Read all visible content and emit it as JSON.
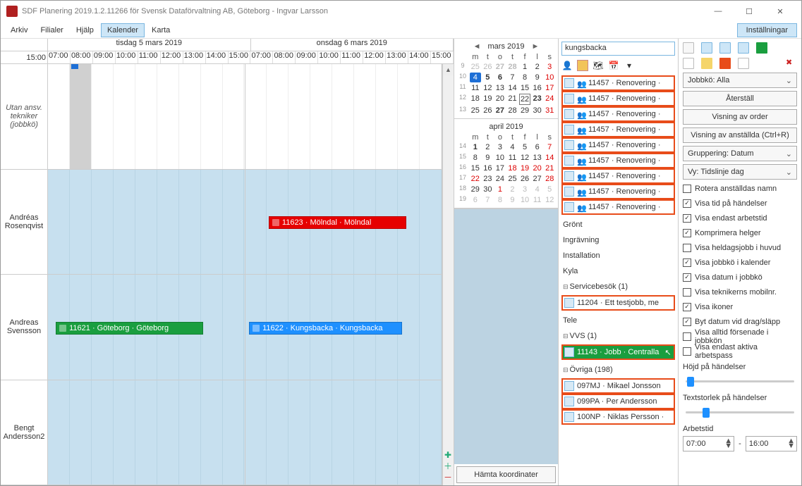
{
  "title": "SDF Planering 2019.1.2.11266 för Svensk Dataförvaltning AB, Göteborg - Ingvar Larsson",
  "menu": {
    "arkiv": "Arkiv",
    "filialer": "Filialer",
    "hjalp": "Hjälp",
    "kalender": "Kalender",
    "karta": "Karta",
    "installningar": "Inställningar"
  },
  "timeline": {
    "day1": "tisdag 5 mars 2019",
    "day2": "onsdag 6 mars 2019",
    "left_hour": "15:00",
    "hours": [
      "07:00",
      "08:00",
      "09:00",
      "10:00",
      "11:00",
      "12:00",
      "13:00",
      "14:00",
      "15:00"
    ],
    "rows": {
      "r0": "Utan ansv. tekniker (jobbkö)",
      "r1": "Andréas Rosenqvist",
      "r2": "Andreas Svensson",
      "r3": "Bengt Andersson2"
    },
    "events": {
      "e1": "11623 · Mölndal · Mölndal",
      "e2": "11621 · Göteborg · Göteborg",
      "e3": "11622 · Kungsbacka · Kungsbacka"
    }
  },
  "cal": {
    "mar": {
      "title": "mars 2019",
      "dow": [
        "m",
        "t",
        "o",
        "t",
        "f",
        "l",
        "s"
      ],
      "weeks": [
        {
          "wk": "9",
          "days": [
            {
              "n": "25",
              "g": 1
            },
            {
              "n": "26",
              "g": 1
            },
            {
              "n": "27",
              "g": 1,
              "b": 1
            },
            {
              "n": "28",
              "g": 1,
              "b": 1
            },
            {
              "n": "1"
            },
            {
              "n": "2"
            },
            {
              "n": "3",
              "r": 1
            }
          ]
        },
        {
          "wk": "10",
          "days": [
            {
              "n": "4",
              "today": 1
            },
            {
              "n": "5",
              "b": 1
            },
            {
              "n": "6",
              "b": 1
            },
            {
              "n": "7"
            },
            {
              "n": "8"
            },
            {
              "n": "9"
            },
            {
              "n": "10",
              "r": 1
            }
          ]
        },
        {
          "wk": "11",
          "days": [
            {
              "n": "11"
            },
            {
              "n": "12"
            },
            {
              "n": "13"
            },
            {
              "n": "14"
            },
            {
              "n": "15"
            },
            {
              "n": "16"
            },
            {
              "n": "17",
              "r": 1
            }
          ]
        },
        {
          "wk": "12",
          "days": [
            {
              "n": "18"
            },
            {
              "n": "19"
            },
            {
              "n": "20"
            },
            {
              "n": "21"
            },
            {
              "n": "22",
              "box": 1
            },
            {
              "n": "23",
              "b": 1
            },
            {
              "n": "24",
              "r": 1
            }
          ]
        },
        {
          "wk": "13",
          "days": [
            {
              "n": "25"
            },
            {
              "n": "26"
            },
            {
              "n": "27",
              "b": 1
            },
            {
              "n": "28"
            },
            {
              "n": "29"
            },
            {
              "n": "30"
            },
            {
              "n": "31",
              "r": 1
            }
          ]
        }
      ]
    },
    "apr": {
      "title": "april 2019",
      "dow": [
        "m",
        "t",
        "o",
        "t",
        "f",
        "l",
        "s"
      ],
      "weeks": [
        {
          "wk": "14",
          "days": [
            {
              "n": "1",
              "b": 1
            },
            {
              "n": "2"
            },
            {
              "n": "3"
            },
            {
              "n": "4"
            },
            {
              "n": "5"
            },
            {
              "n": "6"
            },
            {
              "n": "7",
              "r": 1
            }
          ]
        },
        {
          "wk": "15",
          "days": [
            {
              "n": "8"
            },
            {
              "n": "9"
            },
            {
              "n": "10"
            },
            {
              "n": "11"
            },
            {
              "n": "12"
            },
            {
              "n": "13"
            },
            {
              "n": "14",
              "r": 1
            }
          ]
        },
        {
          "wk": "16",
          "days": [
            {
              "n": "15"
            },
            {
              "n": "16"
            },
            {
              "n": "17"
            },
            {
              "n": "18",
              "r": 1
            },
            {
              "n": "19",
              "r": 1
            },
            {
              "n": "20",
              "r": 1
            },
            {
              "n": "21",
              "r": 1
            }
          ]
        },
        {
          "wk": "17",
          "days": [
            {
              "n": "22",
              "r": 1
            },
            {
              "n": "23"
            },
            {
              "n": "24"
            },
            {
              "n": "25"
            },
            {
              "n": "26"
            },
            {
              "n": "27"
            },
            {
              "n": "28",
              "r": 1
            }
          ]
        },
        {
          "wk": "18",
          "days": [
            {
              "n": "29"
            },
            {
              "n": "30"
            },
            {
              "n": "1",
              "g": 1,
              "r": 1
            },
            {
              "n": "2",
              "g": 1
            },
            {
              "n": "3",
              "g": 1
            },
            {
              "n": "4",
              "g": 1
            },
            {
              "n": "5",
              "g": 1
            }
          ]
        },
        {
          "wk": "19",
          "days": [
            {
              "n": "6",
              "g": 1
            },
            {
              "n": "7",
              "g": 1
            },
            {
              "n": "8",
              "g": 1
            },
            {
              "n": "9",
              "g": 1
            },
            {
              "n": "10",
              "g": 1
            },
            {
              "n": "11",
              "g": 1
            },
            {
              "n": "12",
              "g": 1
            }
          ]
        }
      ]
    },
    "coord_btn": "Hämta koordinater"
  },
  "sidebar": {
    "search": "kungsbacka",
    "renov": [
      "11457 · Renovering ·",
      "11457 · Renovering ·",
      "11457 · Renovering ·",
      "11457 · Renovering ·",
      "11457 · Renovering ·",
      "11457 · Renovering ·",
      "11457 · Renovering ·",
      "11457 · Renovering ·",
      "11457 · Renovering ·"
    ],
    "cats": {
      "gront": "Grönt",
      "ingravning": "Ingrävning",
      "installation": "Installation",
      "kyla": "Kyla",
      "service": "Servicebesök (1)",
      "tele": "Tele",
      "vvs": "VVS (1)",
      "ovriga": "Övriga (198)"
    },
    "service_job": "11204 · Ett testjobb, me",
    "vvs_job": "11143 · Jobb · Centralla",
    "ovriga_items": [
      "097MJ · Mikael Jonsson",
      "099PA · Per Andersson",
      "100NP · Niklas Persson ·"
    ]
  },
  "right": {
    "jobbko": "Jobbkö: Alla",
    "aterstall": "Återställ",
    "visning_order": "Visning av order",
    "visning_anst": "Visning av anställda (Ctrl+R)",
    "gruppering": "Gruppering: Datum",
    "vy": "Vy: Tidslinje dag",
    "checks": {
      "rotera": "Rotera anställdas namn",
      "visa_tid": "Visa tid på händelser",
      "visa_arbetstid": "Visa endast arbetstid",
      "komprimera": "Komprimera helger",
      "heldag": "Visa heldagsjobb i huvud",
      "jobbko_kal": "Visa jobbkö i kalender",
      "datum_jobbko": "Visa datum i jobbkö",
      "tekniker_mob": "Visa teknikerns mobilnr.",
      "ikoner": "Visa ikoner",
      "byt_datum": "Byt datum vid drag/släpp",
      "forsenade": "Visa alltid försenade i jobbkön",
      "aktiva": "Visa endast aktiva arbetspass"
    },
    "hojd": "Höjd på händelser",
    "textstorlek": "Textstorlek på händelser",
    "arbetstid": "Arbetstid",
    "t_from": "07:00",
    "t_to": "16:00",
    "dash": "-"
  }
}
